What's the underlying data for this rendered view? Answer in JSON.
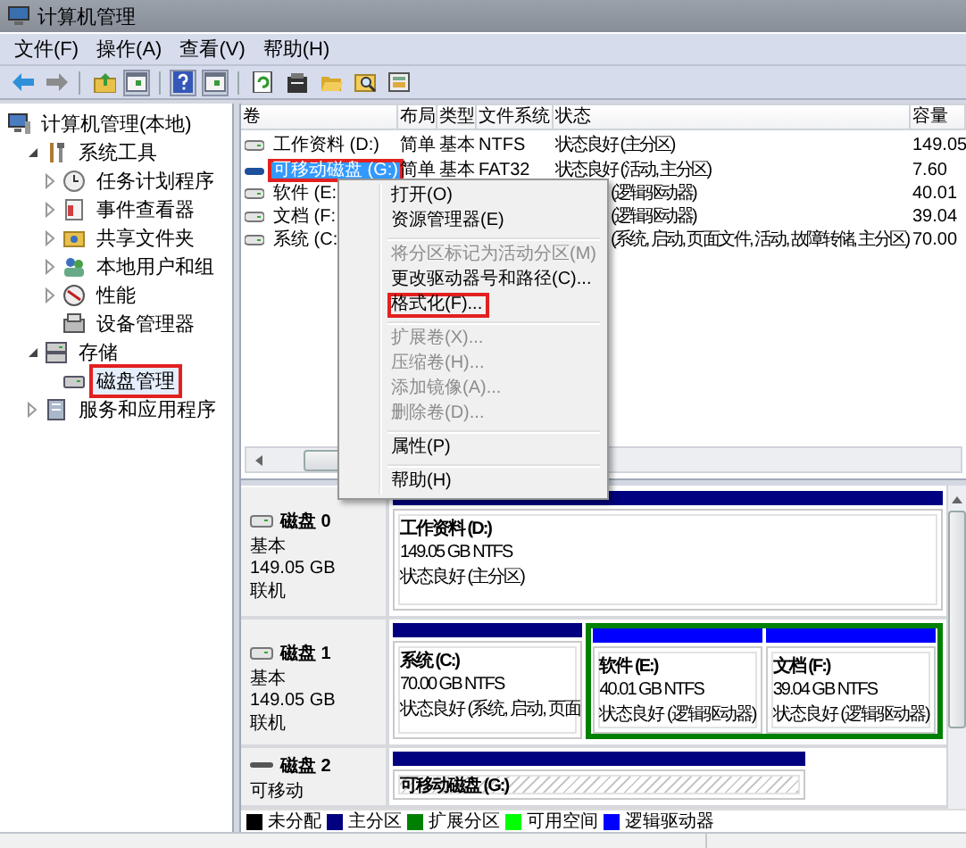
{
  "window": {
    "title": "计算机管理"
  },
  "menu_bar": [
    "文件(F)",
    "操作(A)",
    "查看(V)",
    "帮助(H)"
  ],
  "tree": {
    "label": "计算机管理(本地)",
    "selected": false,
    "marked": false,
    "children": [
      {
        "label": "系统工具",
        "selected": false,
        "marked": false,
        "expanded": true,
        "children": [
          {
            "label": "任务计划程序",
            "selected": false,
            "marked": false,
            "expanded": false
          },
          {
            "label": "事件查看器",
            "selected": false,
            "marked": false,
            "expanded": false
          },
          {
            "label": "共享文件夹",
            "selected": false,
            "marked": false,
            "expanded": false
          },
          {
            "label": "本地用户和组",
            "selected": false,
            "marked": false,
            "expanded": false
          },
          {
            "label": "性能",
            "selected": false,
            "marked": false,
            "expanded": false
          },
          {
            "label": "设备管理器",
            "selected": false,
            "marked": false
          }
        ]
      },
      {
        "label": "存储",
        "selected": false,
        "marked": false,
        "expanded": true,
        "children": [
          {
            "label": "磁盘管理",
            "selected": true,
            "marked": true
          }
        ]
      },
      {
        "label": "服务和应用程序",
        "selected": false,
        "marked": false,
        "expanded": false
      }
    ]
  },
  "table": {
    "columns": [
      "卷",
      "布局",
      "类型",
      "文件系统",
      "状态",
      "容量"
    ],
    "rows": [
      {
        "kind": "disk",
        "cells": [
          "工作资料 (D:)",
          "简单",
          "基本",
          "NTFS",
          "状态良好 (主分区)",
          "149.05"
        ],
        "selected": false,
        "marked": false
      },
      {
        "kind": "removable",
        "cells": [
          "可移动磁盘 (G:)",
          "简单",
          "基本",
          "FAT32",
          "状态良好 (活动, 主分区)",
          "7.60"
        ],
        "selected": true,
        "marked": true
      },
      {
        "kind": "disk",
        "cells": [
          "软件 (E:",
          null,
          null,
          null,
          "(逻辑驱动器)",
          "40.01"
        ],
        "selected": false,
        "marked": false
      },
      {
        "kind": "disk",
        "cells": [
          "文档 (F:",
          null,
          null,
          null,
          "(逻辑驱动器)",
          "39.04"
        ],
        "selected": false,
        "marked": false
      },
      {
        "kind": "disk",
        "cells": [
          "系统 (C:",
          null,
          null,
          null,
          "(系统, 启动, 页面文件, 活动, 故障转储, 主分区)",
          "70.00"
        ],
        "selected": false,
        "marked": false
      }
    ]
  },
  "context_menu": {
    "items": [
      {
        "kind": "item",
        "label": "打开(O)",
        "disabled": false,
        "marked": false
      },
      {
        "kind": "item",
        "label": "资源管理器(E)",
        "disabled": false,
        "marked": false
      },
      {
        "kind": "separator"
      },
      {
        "kind": "item",
        "label": "将分区标记为活动分区(M)",
        "disabled": true,
        "marked": false
      },
      {
        "kind": "item",
        "label": "更改驱动器号和路径(C)...",
        "disabled": false,
        "marked": false
      },
      {
        "kind": "item",
        "label": "格式化(F)...",
        "disabled": false,
        "marked": true
      },
      {
        "kind": "separator"
      },
      {
        "kind": "item",
        "label": "扩展卷(X)...",
        "disabled": true,
        "marked": false
      },
      {
        "kind": "item",
        "label": "压缩卷(H)...",
        "disabled": true,
        "marked": false
      },
      {
        "kind": "item",
        "label": "添加镜像(A)...",
        "disabled": true,
        "marked": false
      },
      {
        "kind": "item",
        "label": "删除卷(D)...",
        "disabled": true,
        "marked": false
      },
      {
        "kind": "separator"
      },
      {
        "kind": "item",
        "label": "属性(P)",
        "disabled": false,
        "marked": false
      },
      {
        "kind": "separator"
      },
      {
        "kind": "item",
        "label": "帮助(H)",
        "disabled": false,
        "marked": false
      }
    ]
  },
  "disks": [
    {
      "name": "磁盘 0",
      "kind": "disk",
      "type": "基本",
      "size": "149.05 GB",
      "status": "联机",
      "partitions": [
        {
          "kind": "primary",
          "name": "工作资料  (D:)",
          "size": "149.05 GB NTFS",
          "status": "状态良好 (主分区)",
          "selected": false
        }
      ]
    },
    {
      "name": "磁盘 1",
      "kind": "disk",
      "type": "基本",
      "size": "149.05 GB",
      "status": "联机",
      "partitions": [
        {
          "kind": "primary",
          "name": "系统  (C:)",
          "size": "70.00 GB NTFS",
          "status": "状态良好 (系统, 启动, 页面",
          "selected": false
        },
        {
          "kind": "extended",
          "children": [
            {
              "kind": "logical",
              "name": "软件  (E:)",
              "size": "40.01 GB NTFS",
              "status": "状态良好 (逻辑驱动器)",
              "selected": false
            },
            {
              "kind": "logical",
              "name": "文档  (F:)",
              "size": "39.04 GB NTFS",
              "status": "状态良好 (逻辑驱动器)",
              "selected": false
            }
          ]
        }
      ]
    },
    {
      "name": "磁盘 2",
      "kind": "removable",
      "type": "可移动",
      "partitions": [
        {
          "kind": "primary",
          "name": "可移动磁盘  (G:)",
          "selected": true
        }
      ]
    }
  ],
  "legend": [
    {
      "label": "未分配",
      "color": "#000000"
    },
    {
      "label": "主分区",
      "color": "#000080"
    },
    {
      "label": "扩展分区",
      "color": "#008000"
    },
    {
      "label": "可用空间",
      "color": "#00ff00"
    },
    {
      "label": "逻辑驱动器",
      "color": "#0000ff"
    }
  ]
}
